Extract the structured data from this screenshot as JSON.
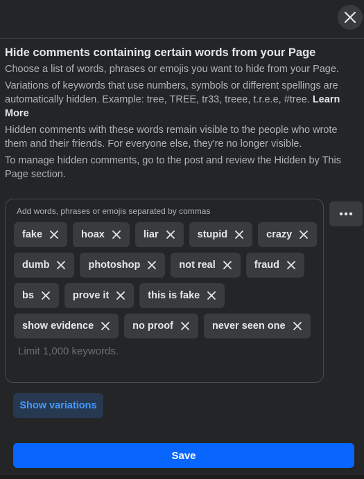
{
  "dialog": {
    "close_icon": "close-icon",
    "title": "Hide comments containing certain words from your Page",
    "paragraphs": {
      "p1": "Choose a list of words, phrases or emojis you want to hide from your Page.",
      "p2": "Variations of keywords that use numbers, symbols or different spellings are automatically hidden. Example: tree, TREE, tr33, treee, t.r.e.e, #tree.",
      "p2_link": "Learn More",
      "p3": "Hidden comments with these words remain visible to the people who wrote them and their friends. For everyone else, they're no longer visible.",
      "p4": "To manage hidden comments, go to the post and review the Hidden by This Page section."
    }
  },
  "keywords": {
    "label": "Add words, phrases or emojis separated by commas",
    "chips": [
      "fake",
      "hoax",
      "liar",
      "stupid",
      "crazy",
      "dumb",
      "photoshop",
      "not real",
      "fraud",
      "bs",
      "prove it",
      "this is fake",
      "show evidence",
      "no proof",
      "never seen one"
    ],
    "input_placeholder": "Limit 1,000 keywords.",
    "more_icon": "more-dots-icon"
  },
  "buttons": {
    "show_variations": "Show variations",
    "save": "Save"
  },
  "colors": {
    "background": "#242526",
    "chip": "#3a3b3c",
    "primary": "#0866ff",
    "link_blue": "#4599ff"
  }
}
